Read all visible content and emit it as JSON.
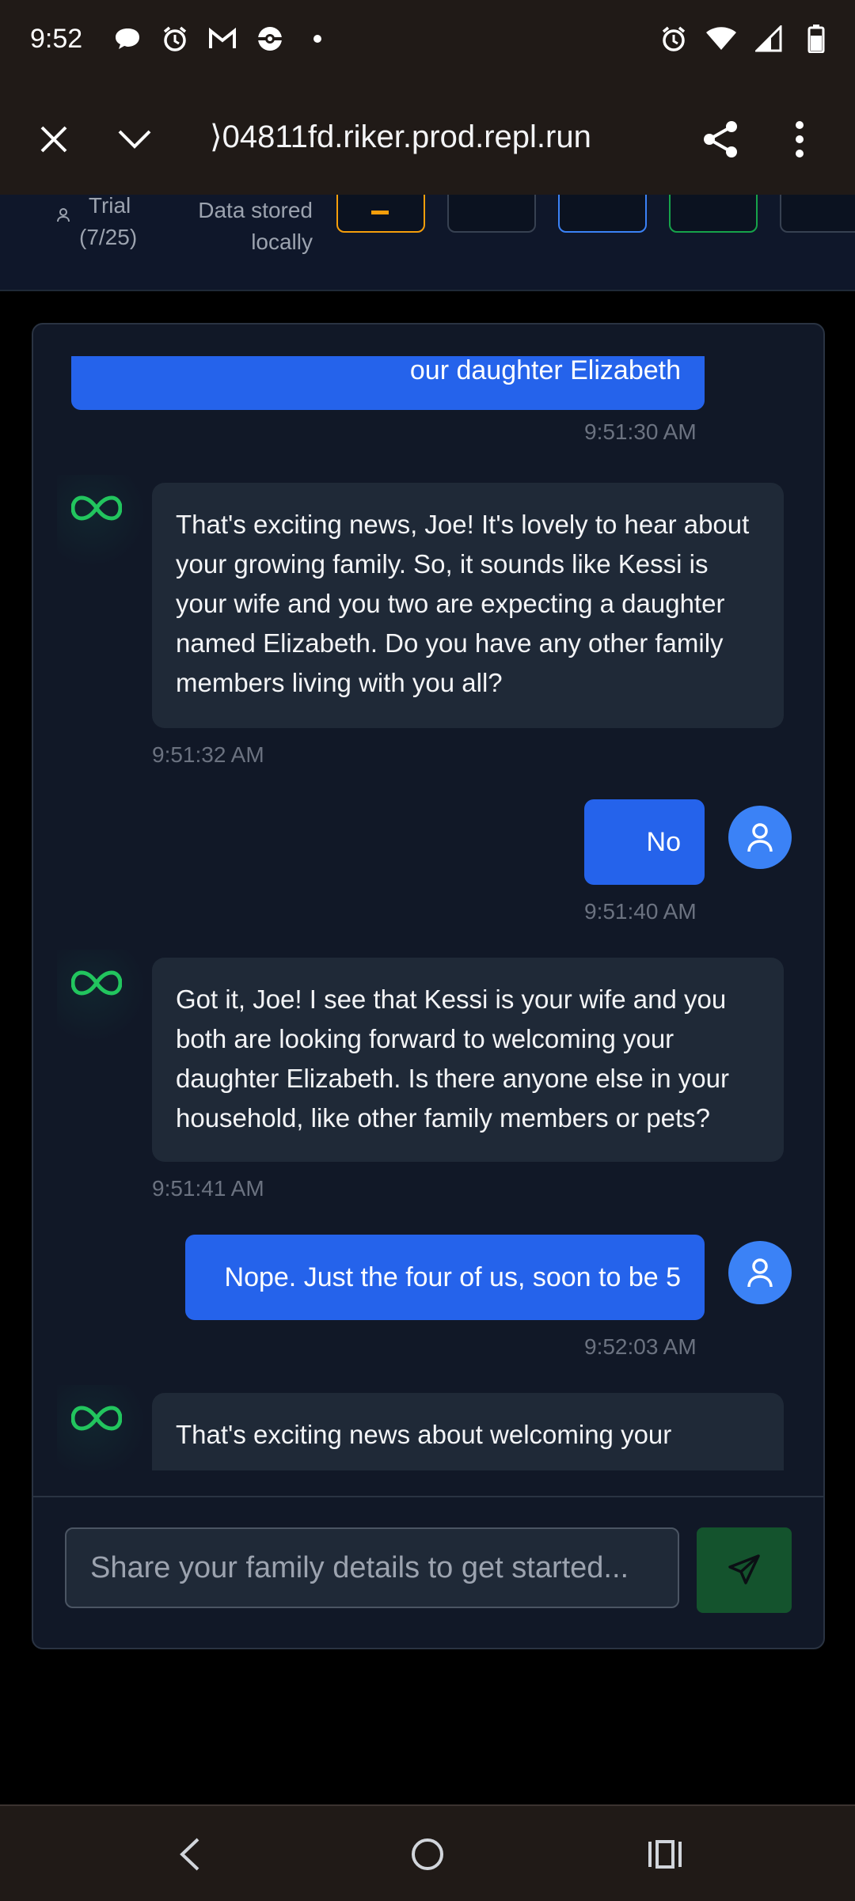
{
  "status_bar": {
    "time": "9:52",
    "left_icons": [
      "chat-bubble-icon",
      "alarm-icon",
      "gmail-icon",
      "pokeball-icon",
      "dot-icon"
    ],
    "right_icons": [
      "alarm-icon",
      "wifi-icon",
      "signal-icon",
      "battery-icon"
    ]
  },
  "browser": {
    "url": "⟩04811fd.riker.prod.repl.run"
  },
  "app_header": {
    "trial_label": "Trial",
    "trial_count": "(7/25)",
    "storage_line1": "Data stored",
    "storage_line2": "locally",
    "button_border_colors": [
      "#f59e0b",
      "#374151",
      "#3b82f6",
      "#16a34a",
      "#374151"
    ]
  },
  "messages": [
    {
      "role": "user",
      "text": "our daughter Elizabeth",
      "time": "9:51:30 AM"
    },
    {
      "role": "assistant",
      "text": "That's exciting news, Joe! It's lovely to hear about your growing family. So, it sounds like Kessi is your wife and you two are expecting a daughter named Elizabeth. Do you have any other family members living with you all?",
      "time": "9:51:32 AM"
    },
    {
      "role": "user",
      "text": "No",
      "time": "9:51:40 AM"
    },
    {
      "role": "assistant",
      "text": "Got it, Joe! I see that Kessi is your wife and you both are looking forward to welcoming your daughter Elizabeth. Is there anyone else in your household, like other family members or pets?",
      "time": "9:51:41 AM"
    },
    {
      "role": "user",
      "text": "Nope. Just the four of us, soon to be 5",
      "time": "9:52:03 AM"
    },
    {
      "role": "assistant",
      "text": "That's exciting news about welcoming your",
      "time": ""
    }
  ],
  "input": {
    "placeholder": "Share your family details to get started..."
  },
  "colors": {
    "user_bubble": "#2563eb",
    "ai_bubble": "#1f2937",
    "ai_icon": "#22c55e",
    "send_button": "#14532d"
  }
}
